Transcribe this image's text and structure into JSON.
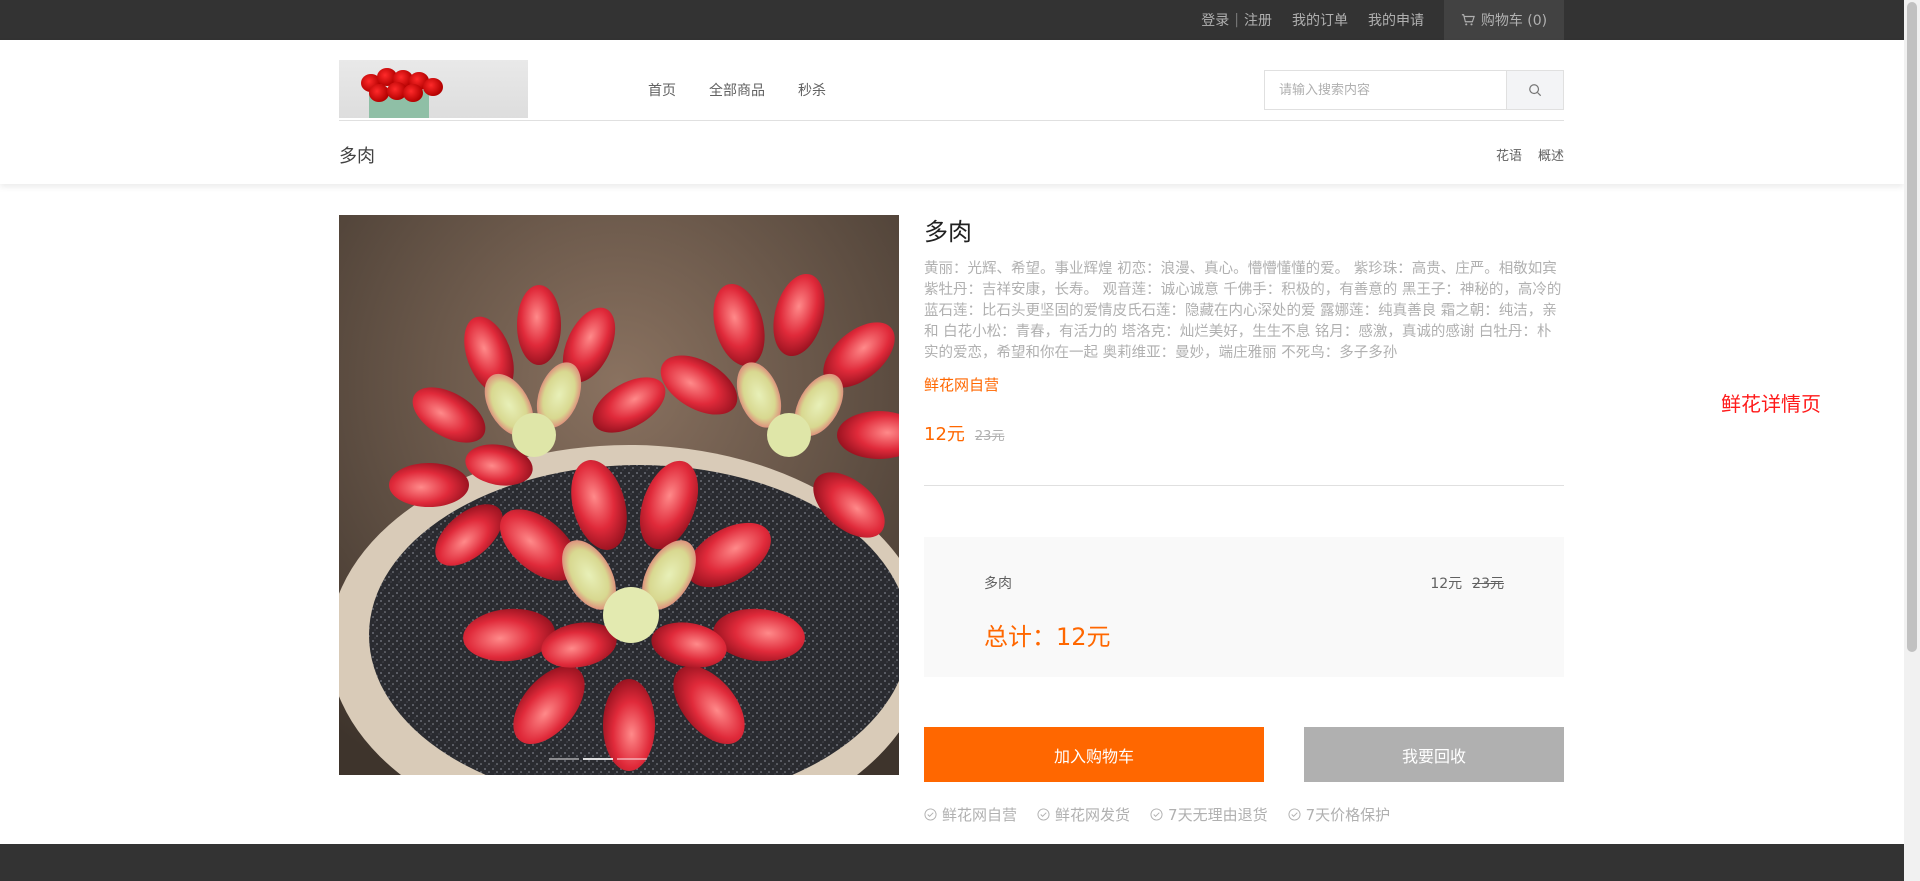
{
  "topbar": {
    "login": "登录",
    "separator": "|",
    "register": "注册",
    "my_orders": "我的订单",
    "my_applications": "我的申请",
    "cart": "购物车 (0)",
    "cart_icon": "cart-icon"
  },
  "header": {
    "logo_alt": "red roses logo",
    "nav": [
      "首页",
      "全部商品",
      "秒杀"
    ],
    "search": {
      "placeholder": "请输入搜索内容",
      "icon": "search-icon"
    },
    "subtitle": "多肉",
    "sublinks": [
      "花语",
      "概述"
    ]
  },
  "product": {
    "title": "多肉",
    "description": "黄丽：光辉、希望。事业辉煌 初恋：浪漫、真心。懵懵懂懂的爱。 紫珍珠：高贵、庄严。相敬如宾 紫牡丹：吉祥安康，长寿。 观音莲：诚心诚意 千佛手：积极的，有善意的 黑王子：神秘的，高冷的 蓝石莲：比石头更坚固的爱情皮氏石莲：隐藏在内心深处的爱 露娜莲：纯真善良 霜之朝：纯洁，亲和 白花小松：青春，有活力的 塔洛克：灿烂美好，生生不息 铭月：感激，真诚的感谢 白牡丹：朴实的爱恋，希望和你在一起 奥莉维亚：曼妙，端庄雅丽 不死鸟：多子多孙",
    "brand": "鲜花网自营",
    "price_now": "12元",
    "price_old": "23元",
    "image_dots": 3
  },
  "summary": {
    "name": "多肉",
    "price_now": "12元",
    "price_old": "23元",
    "total": "总计：12元"
  },
  "actions": {
    "add_to_cart": "加入购物车",
    "recycle": "我要回收"
  },
  "guarantees": [
    "鲜花网自营",
    "鲜花网发货",
    "7天无理由退货",
    "7天价格保护"
  ],
  "side_label": "鲜花详情页",
  "colors": {
    "accent": "#ff6700",
    "topbar_bg": "#333333",
    "side_label": "#ff1a1a",
    "muted": "#b0b0b0"
  }
}
